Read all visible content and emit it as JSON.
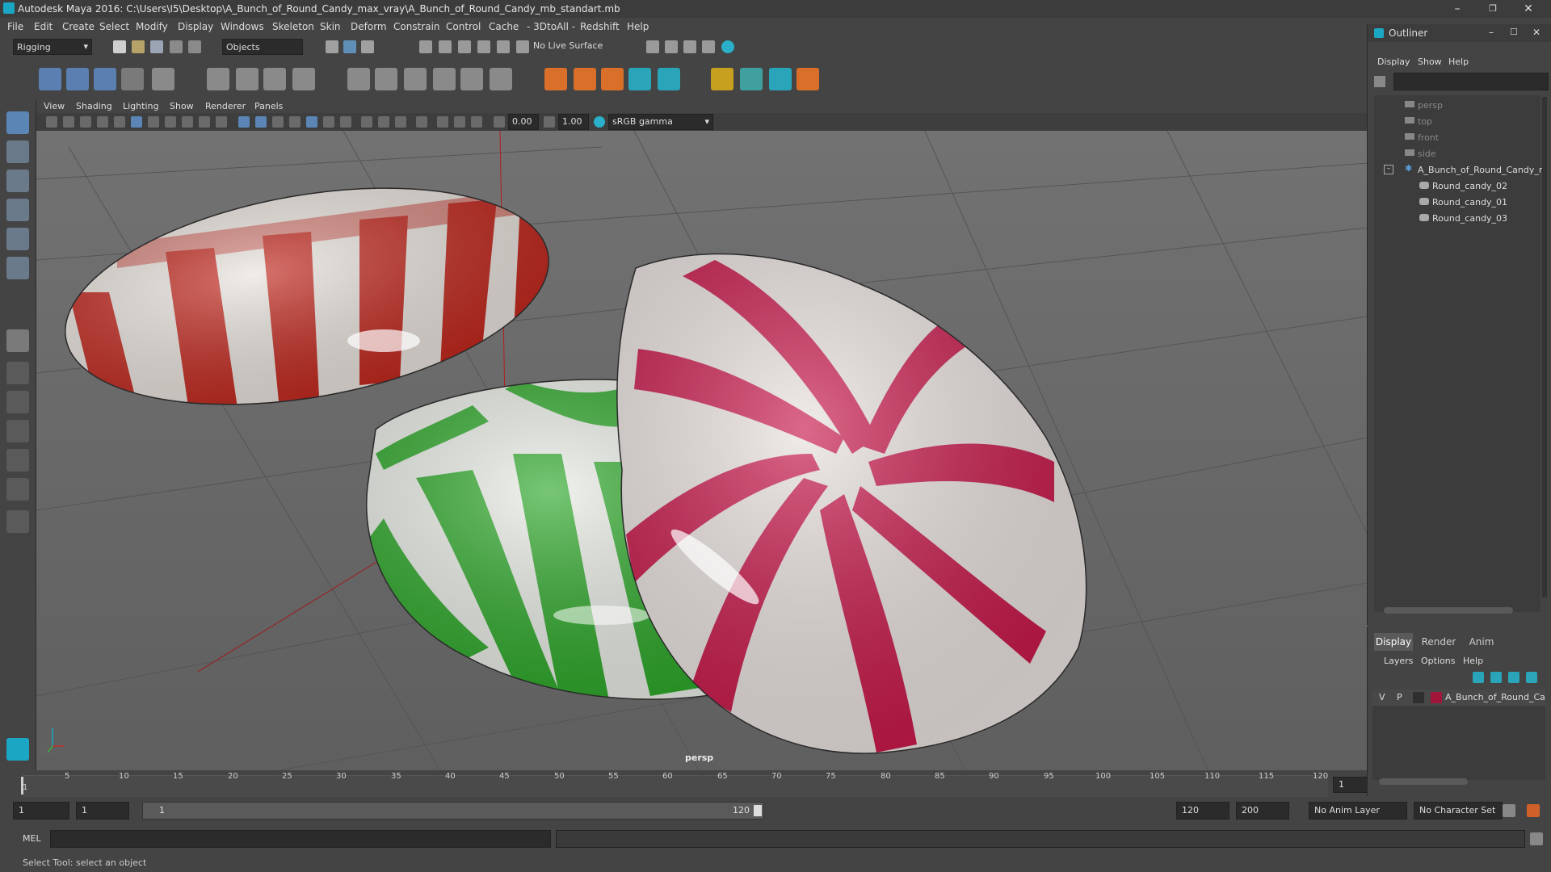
{
  "window": {
    "title": "Autodesk Maya 2016: C:\\Users\\I5\\Desktop\\A_Bunch_of_Round_Candy_max_vray\\A_Bunch_of_Round_Candy_mb_standart.mb",
    "minimize": "–",
    "maximize": "❐",
    "close": "✕"
  },
  "menu": [
    "File",
    "Edit",
    "Create",
    "Select",
    "Modify",
    "Display",
    "Windows",
    "Skeleton",
    "Skin",
    "Deform",
    "Constrain",
    "Control",
    "Cache",
    "- 3DtoAll -",
    "Redshift",
    "Help"
  ],
  "statusline": {
    "mode": "Rigging",
    "selection_mode": "Objects",
    "live_surface": "No Live Surface"
  },
  "viewport": {
    "menu": [
      "View",
      "Shading",
      "Lighting",
      "Show",
      "Renderer",
      "Panels"
    ],
    "exposure": "0.00",
    "gamma": "1.00",
    "colorspace": "sRGB gamma",
    "camera_label": "persp"
  },
  "timeline": {
    "ticks": [
      "1",
      "5",
      "10",
      "15",
      "20",
      "25",
      "30",
      "35",
      "40",
      "45",
      "50",
      "55",
      "60",
      "65",
      "70",
      "75",
      "80",
      "85",
      "90",
      "95",
      "100",
      "105",
      "110",
      "115",
      "120"
    ],
    "current_frame": "1"
  },
  "range": {
    "start": "1",
    "playback_start": "1",
    "slider_start": "1",
    "slider_end": "120",
    "playback_end": "120",
    "end": "200",
    "anim_layer": "No Anim Layer",
    "character_set": "No Character Set"
  },
  "cmdline": {
    "label": "MEL"
  },
  "helpline": {
    "text": "Select Tool: select an object"
  },
  "outliner": {
    "title": "Outliner",
    "menu": [
      "Display",
      "Show",
      "Help"
    ],
    "items": [
      {
        "label": "persp",
        "dim": true,
        "indent": 0
      },
      {
        "label": "top",
        "dim": true,
        "indent": 0
      },
      {
        "label": "front",
        "dim": true,
        "indent": 0
      },
      {
        "label": "side",
        "dim": true,
        "indent": 0
      },
      {
        "label": "A_Bunch_of_Round_Candy_n",
        "dim": false,
        "indent": 0
      },
      {
        "label": "Round_candy_02",
        "dim": false,
        "indent": 1
      },
      {
        "label": "Round_candy_01",
        "dim": false,
        "indent": 1
      },
      {
        "label": "Round_candy_03",
        "dim": false,
        "indent": 1
      }
    ]
  },
  "layers": {
    "tabs": [
      "Display",
      "Render",
      "Anim"
    ],
    "menu": [
      "Layers",
      "Options",
      "Help"
    ],
    "layer": {
      "v": "V",
      "p": "P",
      "name": "A_Bunch_of_Round_Ca",
      "color": "#a0163a"
    }
  },
  "colors": {
    "red_stripe": "#c0281e",
    "green_stripe": "#2ea82a",
    "pink_stripe": "#c8184a",
    "cream": "#e8e2dc",
    "maya_accent": "#1ba7c4"
  }
}
